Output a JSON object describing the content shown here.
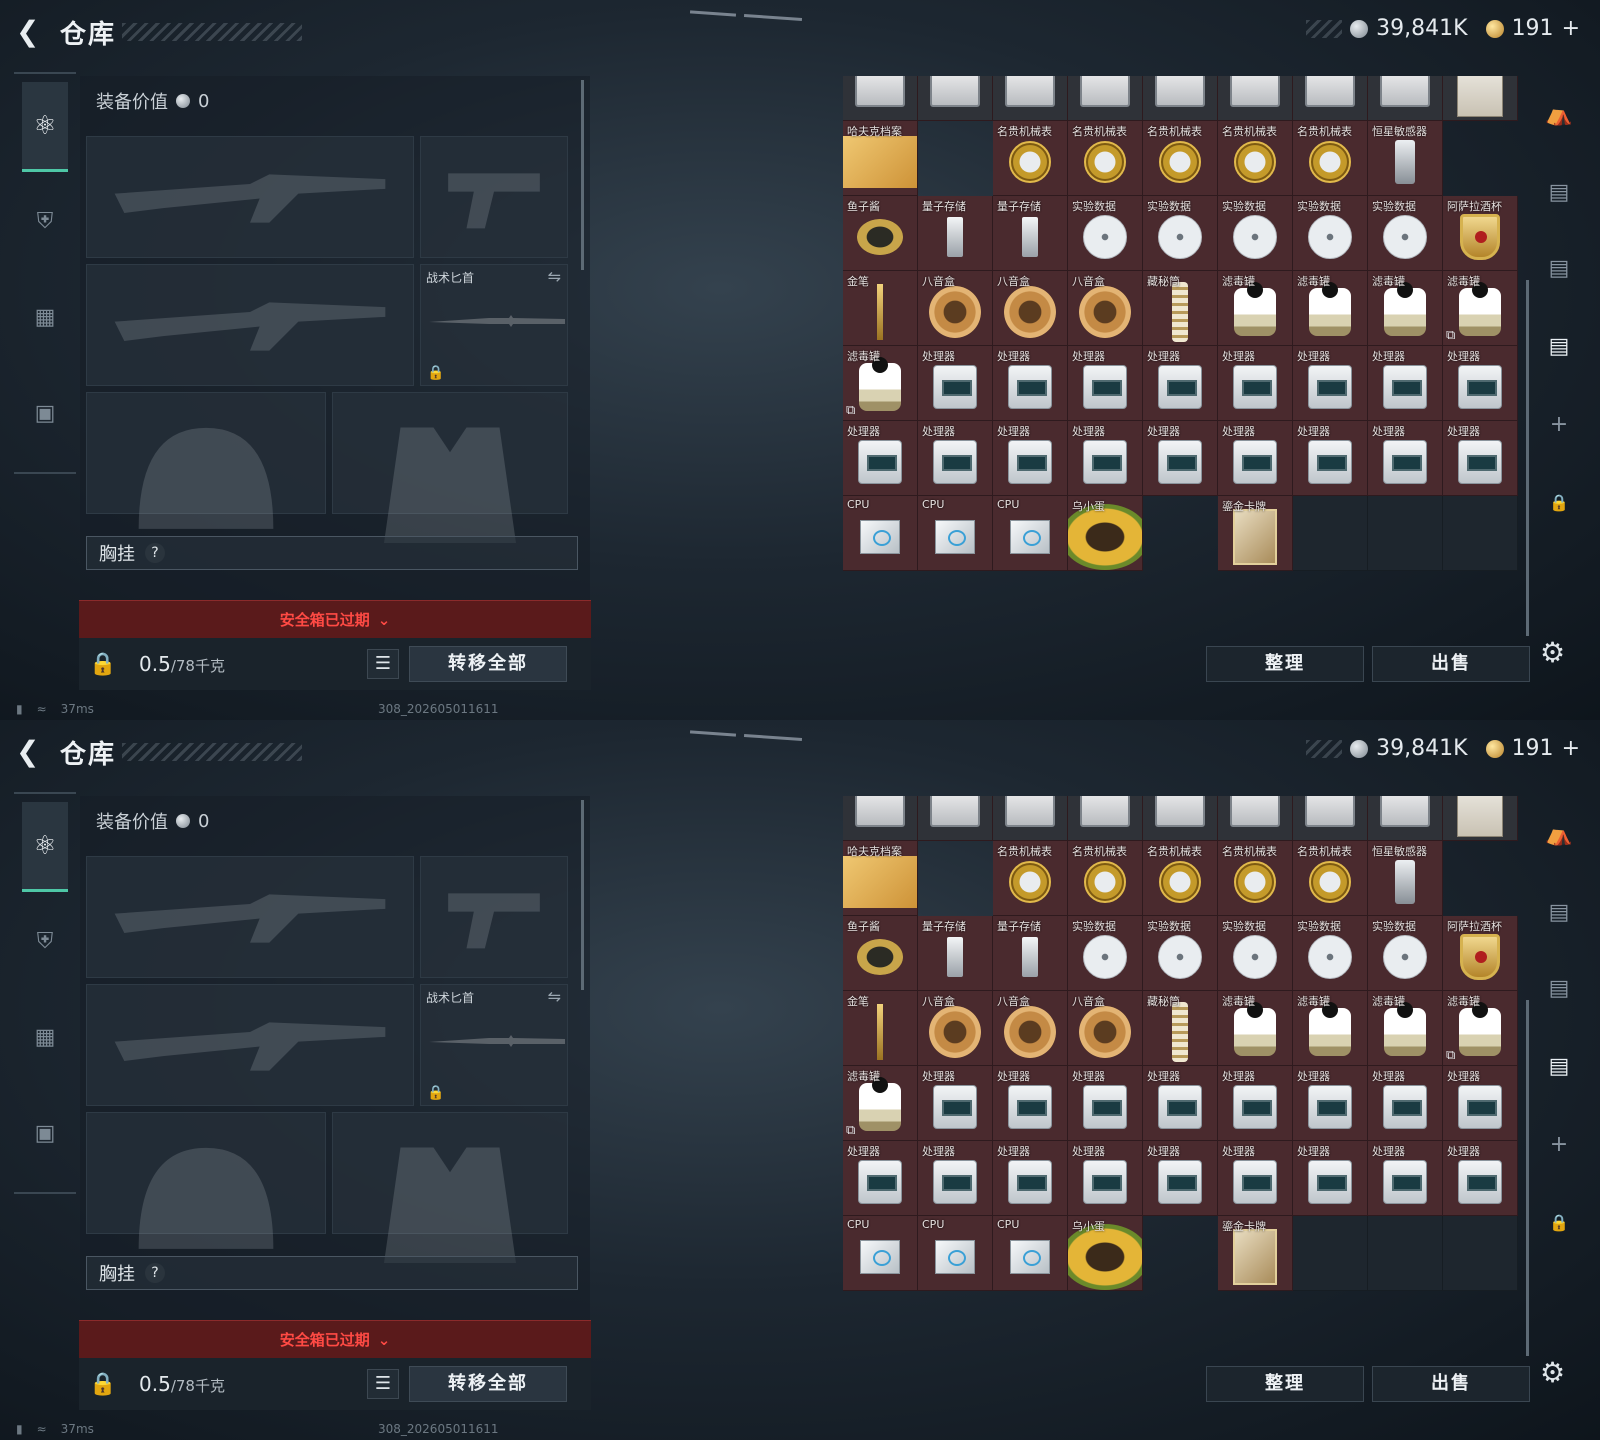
{
  "screens": [
    {
      "header": {
        "title": "仓库",
        "currency_silver": "39,841K",
        "currency_gold": "191",
        "currency_plus": "+"
      },
      "equipment": {
        "value_label": "装备价值",
        "value": "0",
        "melee_label": "战术匕首",
        "chest_label": "胸挂",
        "chest_help": "?",
        "expired_text": "安全箱已过期",
        "weight_current": "0.5",
        "weight_max": "/78千克",
        "transfer_label": "转移全部"
      },
      "grid": {
        "items": [
          {
            "name": "",
            "pic": "box"
          },
          {
            "name": "",
            "pic": "box"
          },
          {
            "name": "",
            "pic": "box"
          },
          {
            "name": "",
            "pic": "box"
          },
          {
            "name": "",
            "pic": "box"
          },
          {
            "name": "",
            "pic": "box"
          },
          {
            "name": "",
            "pic": "box"
          },
          {
            "name": "",
            "pic": "box"
          },
          {
            "name": "",
            "pic": "barista"
          },
          {
            "name": "哈夫克档案",
            "pic": "folder"
          },
          {
            "name": "",
            "pic": ""
          },
          {
            "name": "名贵机械表",
            "pic": "watch"
          },
          {
            "name": "名贵机械表",
            "pic": "watch"
          },
          {
            "name": "名贵机械表",
            "pic": "watch"
          },
          {
            "name": "名贵机械表",
            "pic": "watch"
          },
          {
            "name": "名贵机械表",
            "pic": "watch"
          },
          {
            "name": "恒星敏感器",
            "pic": "sensor"
          },
          {
            "name": "",
            "pic": ""
          },
          {
            "name": "鱼子酱",
            "pic": "caviar"
          },
          {
            "name": "量子存储",
            "pic": "usb"
          },
          {
            "name": "量子存储",
            "pic": "usb"
          },
          {
            "name": "实验数据",
            "pic": "disc"
          },
          {
            "name": "实验数据",
            "pic": "disc"
          },
          {
            "name": "实验数据",
            "pic": "disc"
          },
          {
            "name": "实验数据",
            "pic": "disc"
          },
          {
            "name": "实验数据",
            "pic": "disc"
          },
          {
            "name": "阿萨拉酒杯",
            "pic": "cup"
          },
          {
            "name": "金笔",
            "pic": "pen"
          },
          {
            "name": "八音盒",
            "pic": "music"
          },
          {
            "name": "八音盒",
            "pic": "music"
          },
          {
            "name": "八音盒",
            "pic": "music"
          },
          {
            "name": "藏秘筒",
            "pic": "tube"
          },
          {
            "name": "滤毒罐",
            "pic": "filter"
          },
          {
            "name": "滤毒罐",
            "pic": "filter"
          },
          {
            "name": "滤毒罐",
            "pic": "filter"
          },
          {
            "name": "滤毒罐",
            "pic": "filter",
            "mark": true
          },
          {
            "name": "滤毒罐",
            "pic": "filter",
            "mark": true
          },
          {
            "name": "处理器",
            "pic": "proc"
          },
          {
            "name": "处理器",
            "pic": "proc"
          },
          {
            "name": "处理器",
            "pic": "proc"
          },
          {
            "name": "处理器",
            "pic": "proc"
          },
          {
            "name": "处理器",
            "pic": "proc"
          },
          {
            "name": "处理器",
            "pic": "proc"
          },
          {
            "name": "处理器",
            "pic": "proc"
          },
          {
            "name": "处理器",
            "pic": "proc"
          },
          {
            "name": "处理器",
            "pic": "proc"
          },
          {
            "name": "处理器",
            "pic": "proc"
          },
          {
            "name": "处理器",
            "pic": "proc"
          },
          {
            "name": "处理器",
            "pic": "proc"
          },
          {
            "name": "处理器",
            "pic": "proc"
          },
          {
            "name": "处理器",
            "pic": "proc"
          },
          {
            "name": "处理器",
            "pic": "proc"
          },
          {
            "name": "处理器",
            "pic": "proc"
          },
          {
            "name": "处理器",
            "pic": "proc"
          },
          {
            "name": "CPU",
            "pic": "cpu"
          },
          {
            "name": "CPU",
            "pic": "cpu"
          },
          {
            "name": "CPU",
            "pic": "cpu"
          },
          {
            "name": "乌小蛋",
            "pic": "egg",
            "wide": true
          },
          {
            "name": "鎏金卡牌",
            "pic": "card"
          },
          {
            "name": "",
            "pic": "",
            "empty": true
          },
          {
            "name": "",
            "pic": "",
            "empty": true
          },
          {
            "name": "",
            "pic": "",
            "empty": true
          }
        ]
      },
      "actions": {
        "sort_label": "整理",
        "sell_label": "出售"
      },
      "status": {
        "ping": "37ms",
        "build_id": "308_202605011611"
      }
    }
  ],
  "colors": {
    "accent": "#4ec7a6",
    "expired_bg": "#5a1a1b",
    "expired_text": "#ff4a44",
    "cell_bg": "#4a2a2e"
  },
  "icons": {
    "back": "chevron-left-icon",
    "nav": [
      "pistol-icon",
      "armor-icon",
      "backpack-icon",
      "toolbox-icon"
    ],
    "right_nav": [
      "helmet-icon",
      "storage-iv-icon",
      "storage-iii-icon",
      "camera-icon",
      "plus-icon",
      "lock-icon"
    ],
    "settings": "gear-icon"
  }
}
